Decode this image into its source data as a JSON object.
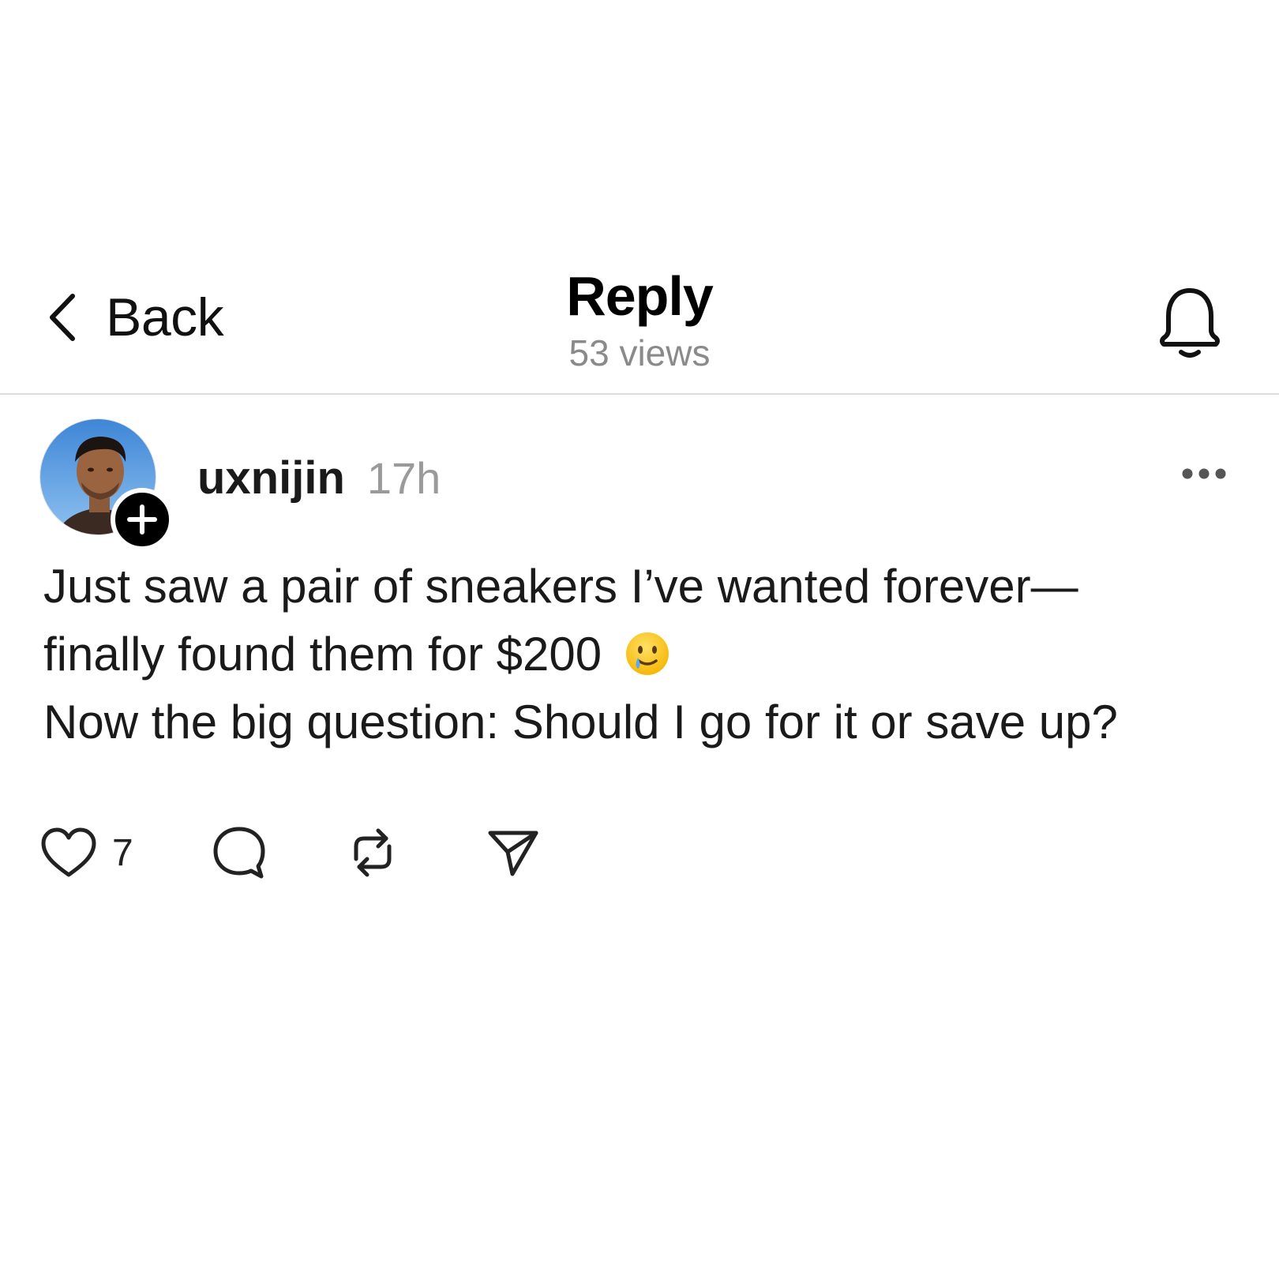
{
  "header": {
    "back_label": "Back",
    "title": "Reply",
    "subtitle": "53 views"
  },
  "post": {
    "username": "uxnijin",
    "time": "17h",
    "text_lines": [
      "Just saw a pair of sneakers I’ve wanted forever—",
      "finally found them for $200",
      "Now the big question: Should I go for it or save up?"
    ],
    "emoji": "smiling-face-with-tear",
    "like_count": "7"
  },
  "icons": {
    "back": "chevron-left-icon",
    "bell": "bell-icon",
    "more": "more-horizontal-icon",
    "follow": "plus-icon",
    "like": "heart-icon",
    "comment": "comment-icon",
    "repost": "repost-icon",
    "share": "send-icon"
  }
}
